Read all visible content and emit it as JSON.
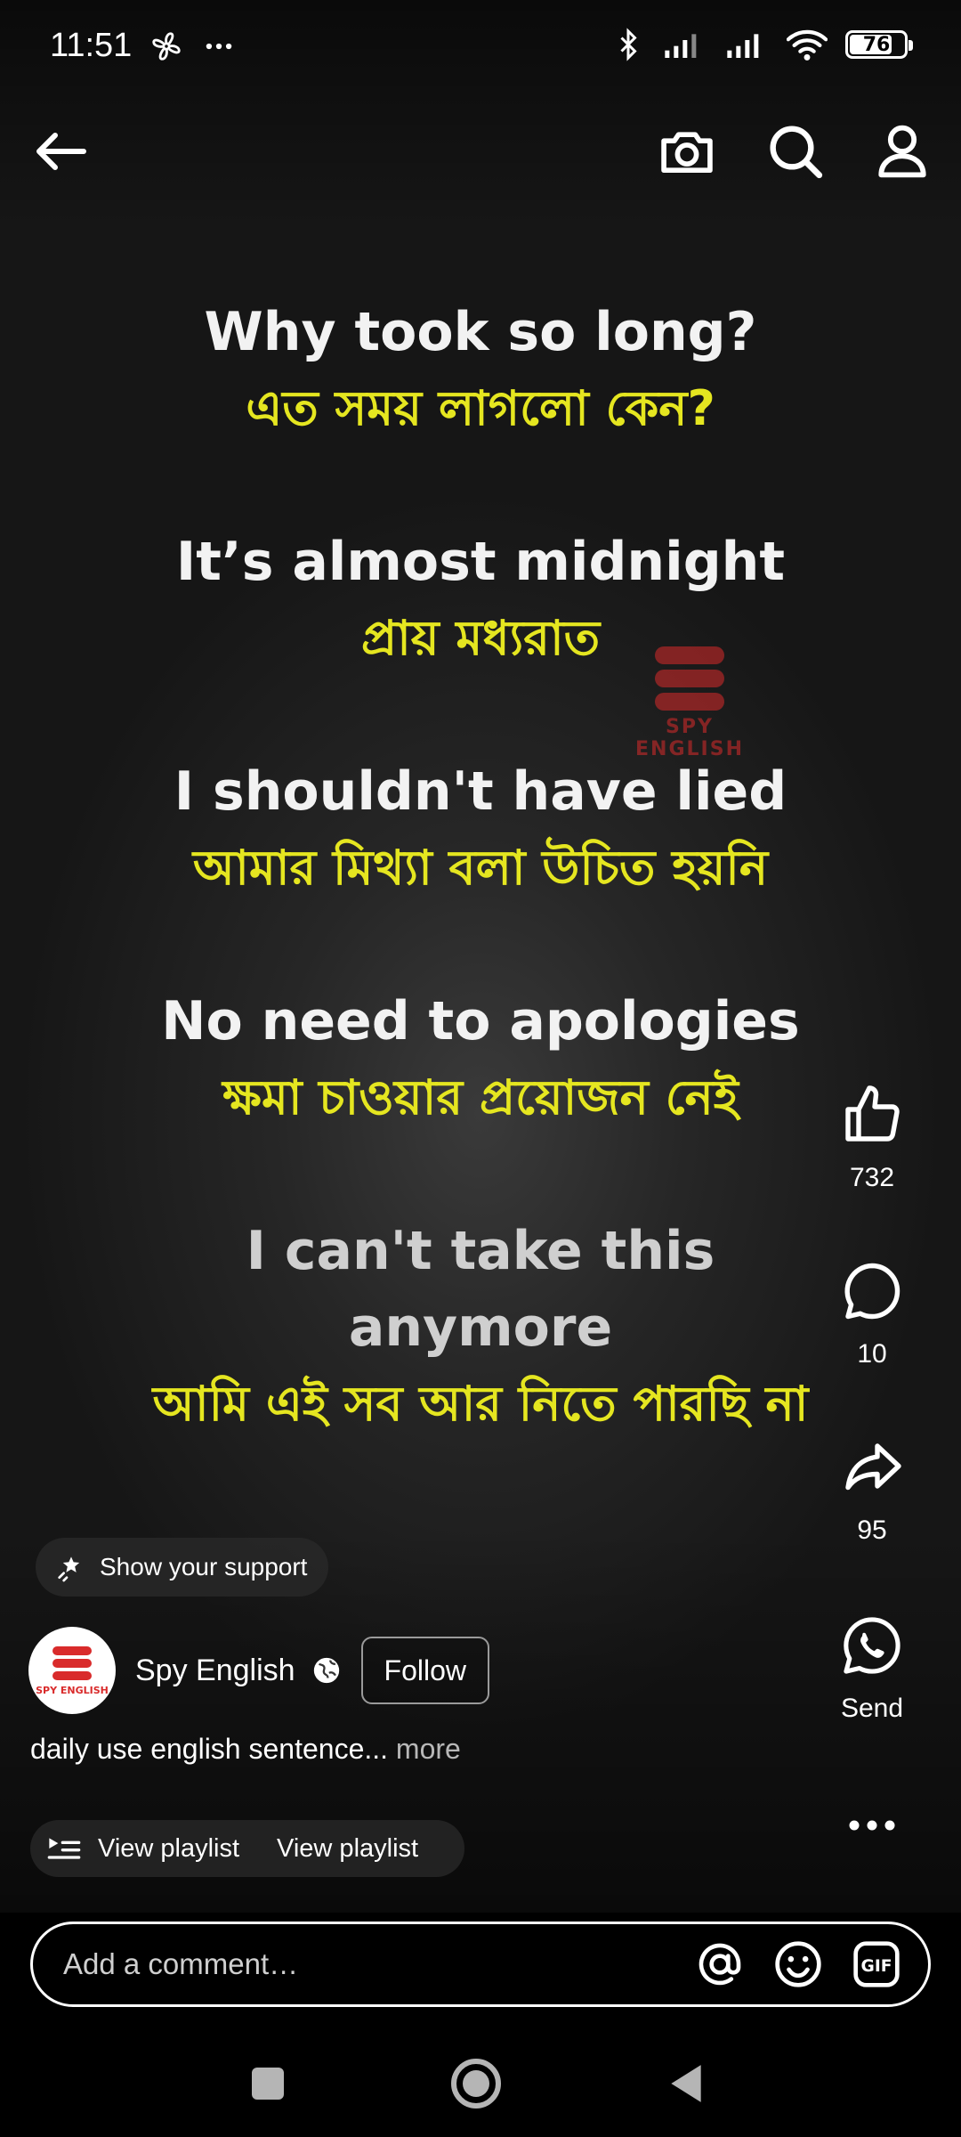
{
  "status_bar": {
    "time": "11:51",
    "battery": "76",
    "left_icons": [
      "fan-icon",
      "more-dots-icon"
    ],
    "right_icons": [
      "bluetooth-icon",
      "signal-icon",
      "signal-icon",
      "wifi-icon",
      "battery-icon"
    ]
  },
  "top_nav": {
    "icons": [
      "back-arrow-icon",
      "camera-icon",
      "search-icon",
      "profile-icon"
    ]
  },
  "captions": [
    {
      "en": "Why took so long?",
      "bn": "এত সময় লাগলো কেন?"
    },
    {
      "en": "It’s almost midnight",
      "bn": "প্রায় মধ্যরাত"
    },
    {
      "en": "I shouldn't have lied",
      "bn": "আমার মিথ্যা বলা উচিত হয়নি"
    },
    {
      "en": "No need to apologies",
      "bn": "ক্ষমা চাওয়ার প্রয়োজন নেই"
    },
    {
      "en": "I can't take this anymore",
      "bn": "আমি এই সব  আর নিতে পারছি না"
    }
  ],
  "watermark": {
    "text": "SPY ENGLISH"
  },
  "actions": {
    "like_count": "732",
    "comment_count": "10",
    "share_count": "95",
    "send_label": "Send"
  },
  "support": {
    "label": "Show your support"
  },
  "channel": {
    "name": "Spy English",
    "avatar_text": "SPY ENGLISH",
    "follow_label": "Follow"
  },
  "description": {
    "text": "daily use english sentence...",
    "more": "more"
  },
  "playlist": {
    "label1": "View playlist",
    "label2": "View playlist"
  },
  "comment": {
    "placeholder": "Add a comment…",
    "gif_label": "GIF"
  },
  "colors": {
    "caption_yellow": "#e5e620",
    "brand_red": "#d92b2b"
  }
}
